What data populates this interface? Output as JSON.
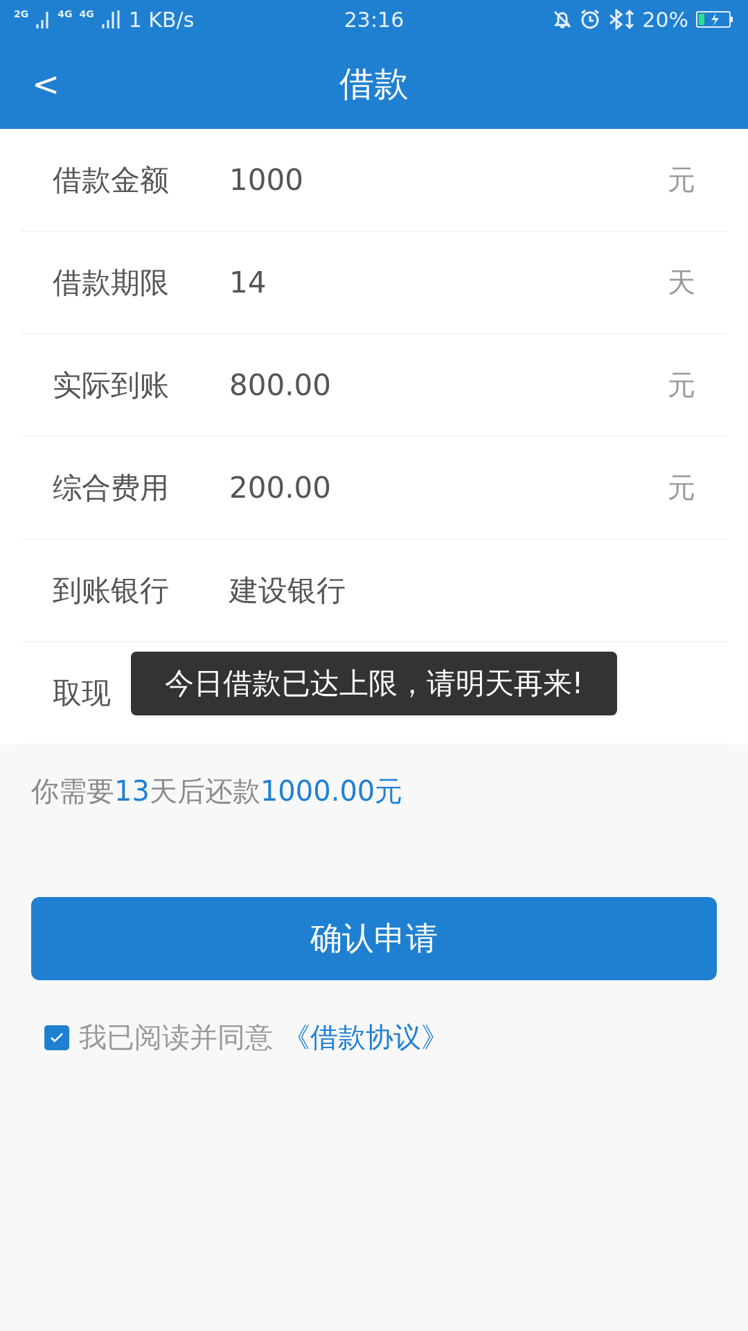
{
  "status_bar": {
    "network_labels": [
      "2G",
      "4G",
      "4G"
    ],
    "speed": "1 KB/s",
    "time": "23:16",
    "battery": "20%"
  },
  "header": {
    "back": "<",
    "title": "借款"
  },
  "fields": [
    {
      "label": "借款金额",
      "value": "1000",
      "unit": "元"
    },
    {
      "label": "借款期限",
      "value": "14",
      "unit": "天"
    },
    {
      "label": "实际到账",
      "value": "800.00",
      "unit": "元"
    },
    {
      "label": "综合费用",
      "value": "200.00",
      "unit": "元"
    },
    {
      "label": "到账银行",
      "value": "建设银行"
    },
    {
      "label": "取现"
    }
  ],
  "toast": "今日借款已达上限，请明天再来!",
  "summary": [
    {
      "text": "你需要",
      "highlight": false
    },
    {
      "text": "13",
      "highlight": true
    },
    {
      "text": "天后还款",
      "highlight": false
    },
    {
      "text": "1000.00元",
      "highlight": true
    }
  ],
  "submit": "确认申请",
  "agreement": {
    "checked": true,
    "text": "我已阅读并同意",
    "link": "《借款协议》"
  }
}
